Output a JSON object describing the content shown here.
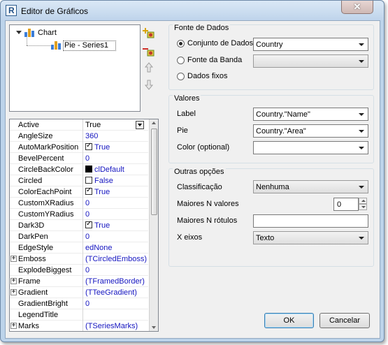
{
  "window": {
    "title": "Editor de Gráficos",
    "close_glyph": "✕"
  },
  "tree": {
    "root_label": "Chart",
    "child_label": "Pie - Series1"
  },
  "inspector": {
    "rows": [
      {
        "name": "Active",
        "value": "True",
        "kind": "combo"
      },
      {
        "name": "AngleSize",
        "value": "360"
      },
      {
        "name": "AutoMarkPosition",
        "value": "True",
        "check": true
      },
      {
        "name": "BevelPercent",
        "value": "0"
      },
      {
        "name": "CircleBackColor",
        "value": "clDefault",
        "swatch": true
      },
      {
        "name": "Circled",
        "value": "False",
        "check": false
      },
      {
        "name": "ColorEachPoint",
        "value": "True",
        "check": true
      },
      {
        "name": "CustomXRadius",
        "value": "0"
      },
      {
        "name": "CustomYRadius",
        "value": "0"
      },
      {
        "name": "Dark3D",
        "value": "True",
        "check": true
      },
      {
        "name": "DarkPen",
        "value": "0"
      },
      {
        "name": "EdgeStyle",
        "value": "edNone"
      },
      {
        "name": "Emboss",
        "value": "(TCircledEmboss)",
        "expand": true
      },
      {
        "name": "ExplodeBiggest",
        "value": "0"
      },
      {
        "name": "Frame",
        "value": "(TFramedBorder)",
        "expand": true
      },
      {
        "name": "Gradient",
        "value": "(TTeeGradient)",
        "expand": true
      },
      {
        "name": "GradientBright",
        "value": "0"
      },
      {
        "name": "LegendTitle",
        "value": ""
      },
      {
        "name": "Marks",
        "value": "(TSeriesMarks)",
        "expand": true
      }
    ]
  },
  "datasource": {
    "group_title": "Fonte de Dados",
    "options": [
      {
        "label": "Conjunto de Dados",
        "selected": true,
        "combo": "Country"
      },
      {
        "label": "Fonte da Banda",
        "selected": false,
        "combo": ""
      },
      {
        "label": "Dados fixos",
        "selected": false
      }
    ]
  },
  "values": {
    "group_title": "Valores",
    "fields": [
      {
        "label": "Label",
        "value": "Country.\"Name\""
      },
      {
        "label": "Pie",
        "value": "Country.\"Area\""
      },
      {
        "label": "Color (optional)",
        "value": ""
      }
    ]
  },
  "other": {
    "group_title": "Outras opções",
    "sort_label": "Classificação",
    "sort_value": "Nenhuma",
    "topn_label": "Maiores N valores",
    "topn_value": "0",
    "topn_captions_label": "Maiores N rótulos",
    "topn_captions_value": "",
    "xaxis_label": "X eixos",
    "xaxis_value": "Texto"
  },
  "buttons": {
    "ok": "OK",
    "cancel": "Cancelar"
  },
  "colors": {
    "title_bar": "#bfd4eb",
    "dialog_bg": "#f0f0f0",
    "value_text": "#1515c0"
  }
}
